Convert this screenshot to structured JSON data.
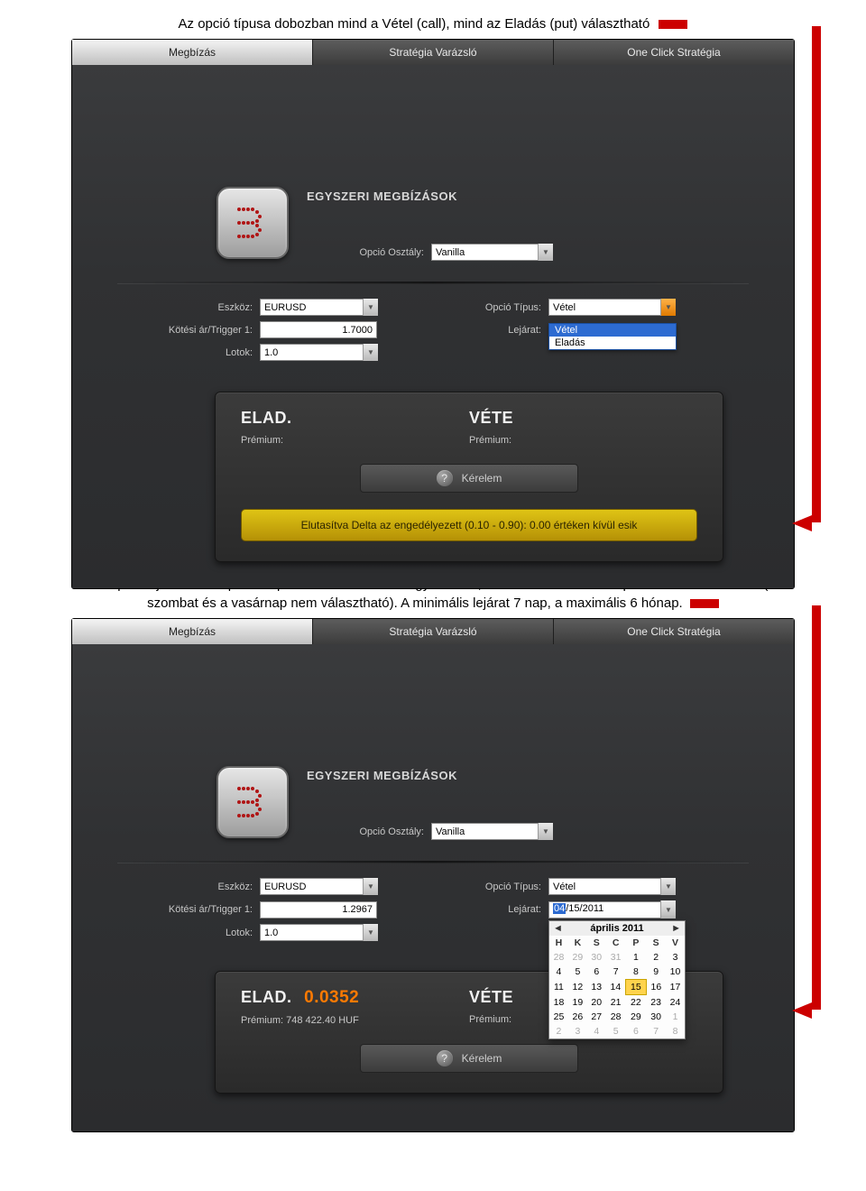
{
  "caption1": "Az opció típusa dobozban mind a Vétel (call), mind az Eladás (put) választható",
  "caption2_line1": "Az opció lejárata a beépített naptárból választható ki egyszerűen, a kiválasztott munkanapra történő kattintással (a",
  "caption2_line2": "szombat és a vasárnap nem választható). A minimális lejárat 7 nap, a maximális 6 hónap.",
  "tabs": {
    "t1": "Megbízás",
    "t2": "Stratégia Varázsló",
    "t3": "One Click Stratégia"
  },
  "section_title": "EGYSZERI MEGBÍZÁSOK",
  "labels": {
    "class": "Opció Osztály:",
    "instrument": "Eszköz:",
    "strike": "Kötési ár/Trigger 1:",
    "lots": "Lotok:",
    "type": "Opció Típus:",
    "expiry": "Lejárat:"
  },
  "values": {
    "class": "Vanilla",
    "instrument": "EURUSD",
    "strike1": "1.7000",
    "strike2": "1.2967",
    "lots": "1.0",
    "type": "Vétel",
    "type_opts": [
      "Vétel",
      "Eladás"
    ],
    "expiry_date": "04/15/2011",
    "expiry_month_sel": "04"
  },
  "card": {
    "sell": "ELAD.",
    "buy": "VÉTE",
    "premium": "Prémium:",
    "price": "0.0352",
    "premium_value": "748 422.40 HUF",
    "request": "Kérelem"
  },
  "banner": "Elutasítva Delta az engedélyezett (0.10 - 0.90): 0.00 értéken kívül esik",
  "calendar": {
    "title": "április 2011",
    "dow": [
      "H",
      "K",
      "S",
      "C",
      "P",
      "S",
      "V"
    ],
    "weeks": [
      [
        {
          "d": "28",
          "off": true
        },
        {
          "d": "29",
          "off": true
        },
        {
          "d": "30",
          "off": true
        },
        {
          "d": "31",
          "off": true
        },
        {
          "d": "1"
        },
        {
          "d": "2"
        },
        {
          "d": "3"
        }
      ],
      [
        {
          "d": "4"
        },
        {
          "d": "5"
        },
        {
          "d": "6"
        },
        {
          "d": "7"
        },
        {
          "d": "8"
        },
        {
          "d": "9"
        },
        {
          "d": "10"
        }
      ],
      [
        {
          "d": "11"
        },
        {
          "d": "12"
        },
        {
          "d": "13"
        },
        {
          "d": "14"
        },
        {
          "d": "15",
          "today": true
        },
        {
          "d": "16"
        },
        {
          "d": "17"
        }
      ],
      [
        {
          "d": "18"
        },
        {
          "d": "19"
        },
        {
          "d": "20"
        },
        {
          "d": "21"
        },
        {
          "d": "22"
        },
        {
          "d": "23"
        },
        {
          "d": "24"
        }
      ],
      [
        {
          "d": "25"
        },
        {
          "d": "26"
        },
        {
          "d": "27"
        },
        {
          "d": "28"
        },
        {
          "d": "29"
        },
        {
          "d": "30"
        },
        {
          "d": "1",
          "off": true
        }
      ],
      [
        {
          "d": "2",
          "off": true
        },
        {
          "d": "3",
          "off": true
        },
        {
          "d": "4",
          "off": true
        },
        {
          "d": "5",
          "off": true
        },
        {
          "d": "6",
          "off": true
        },
        {
          "d": "7",
          "off": true
        },
        {
          "d": "8",
          "off": true
        }
      ]
    ]
  }
}
